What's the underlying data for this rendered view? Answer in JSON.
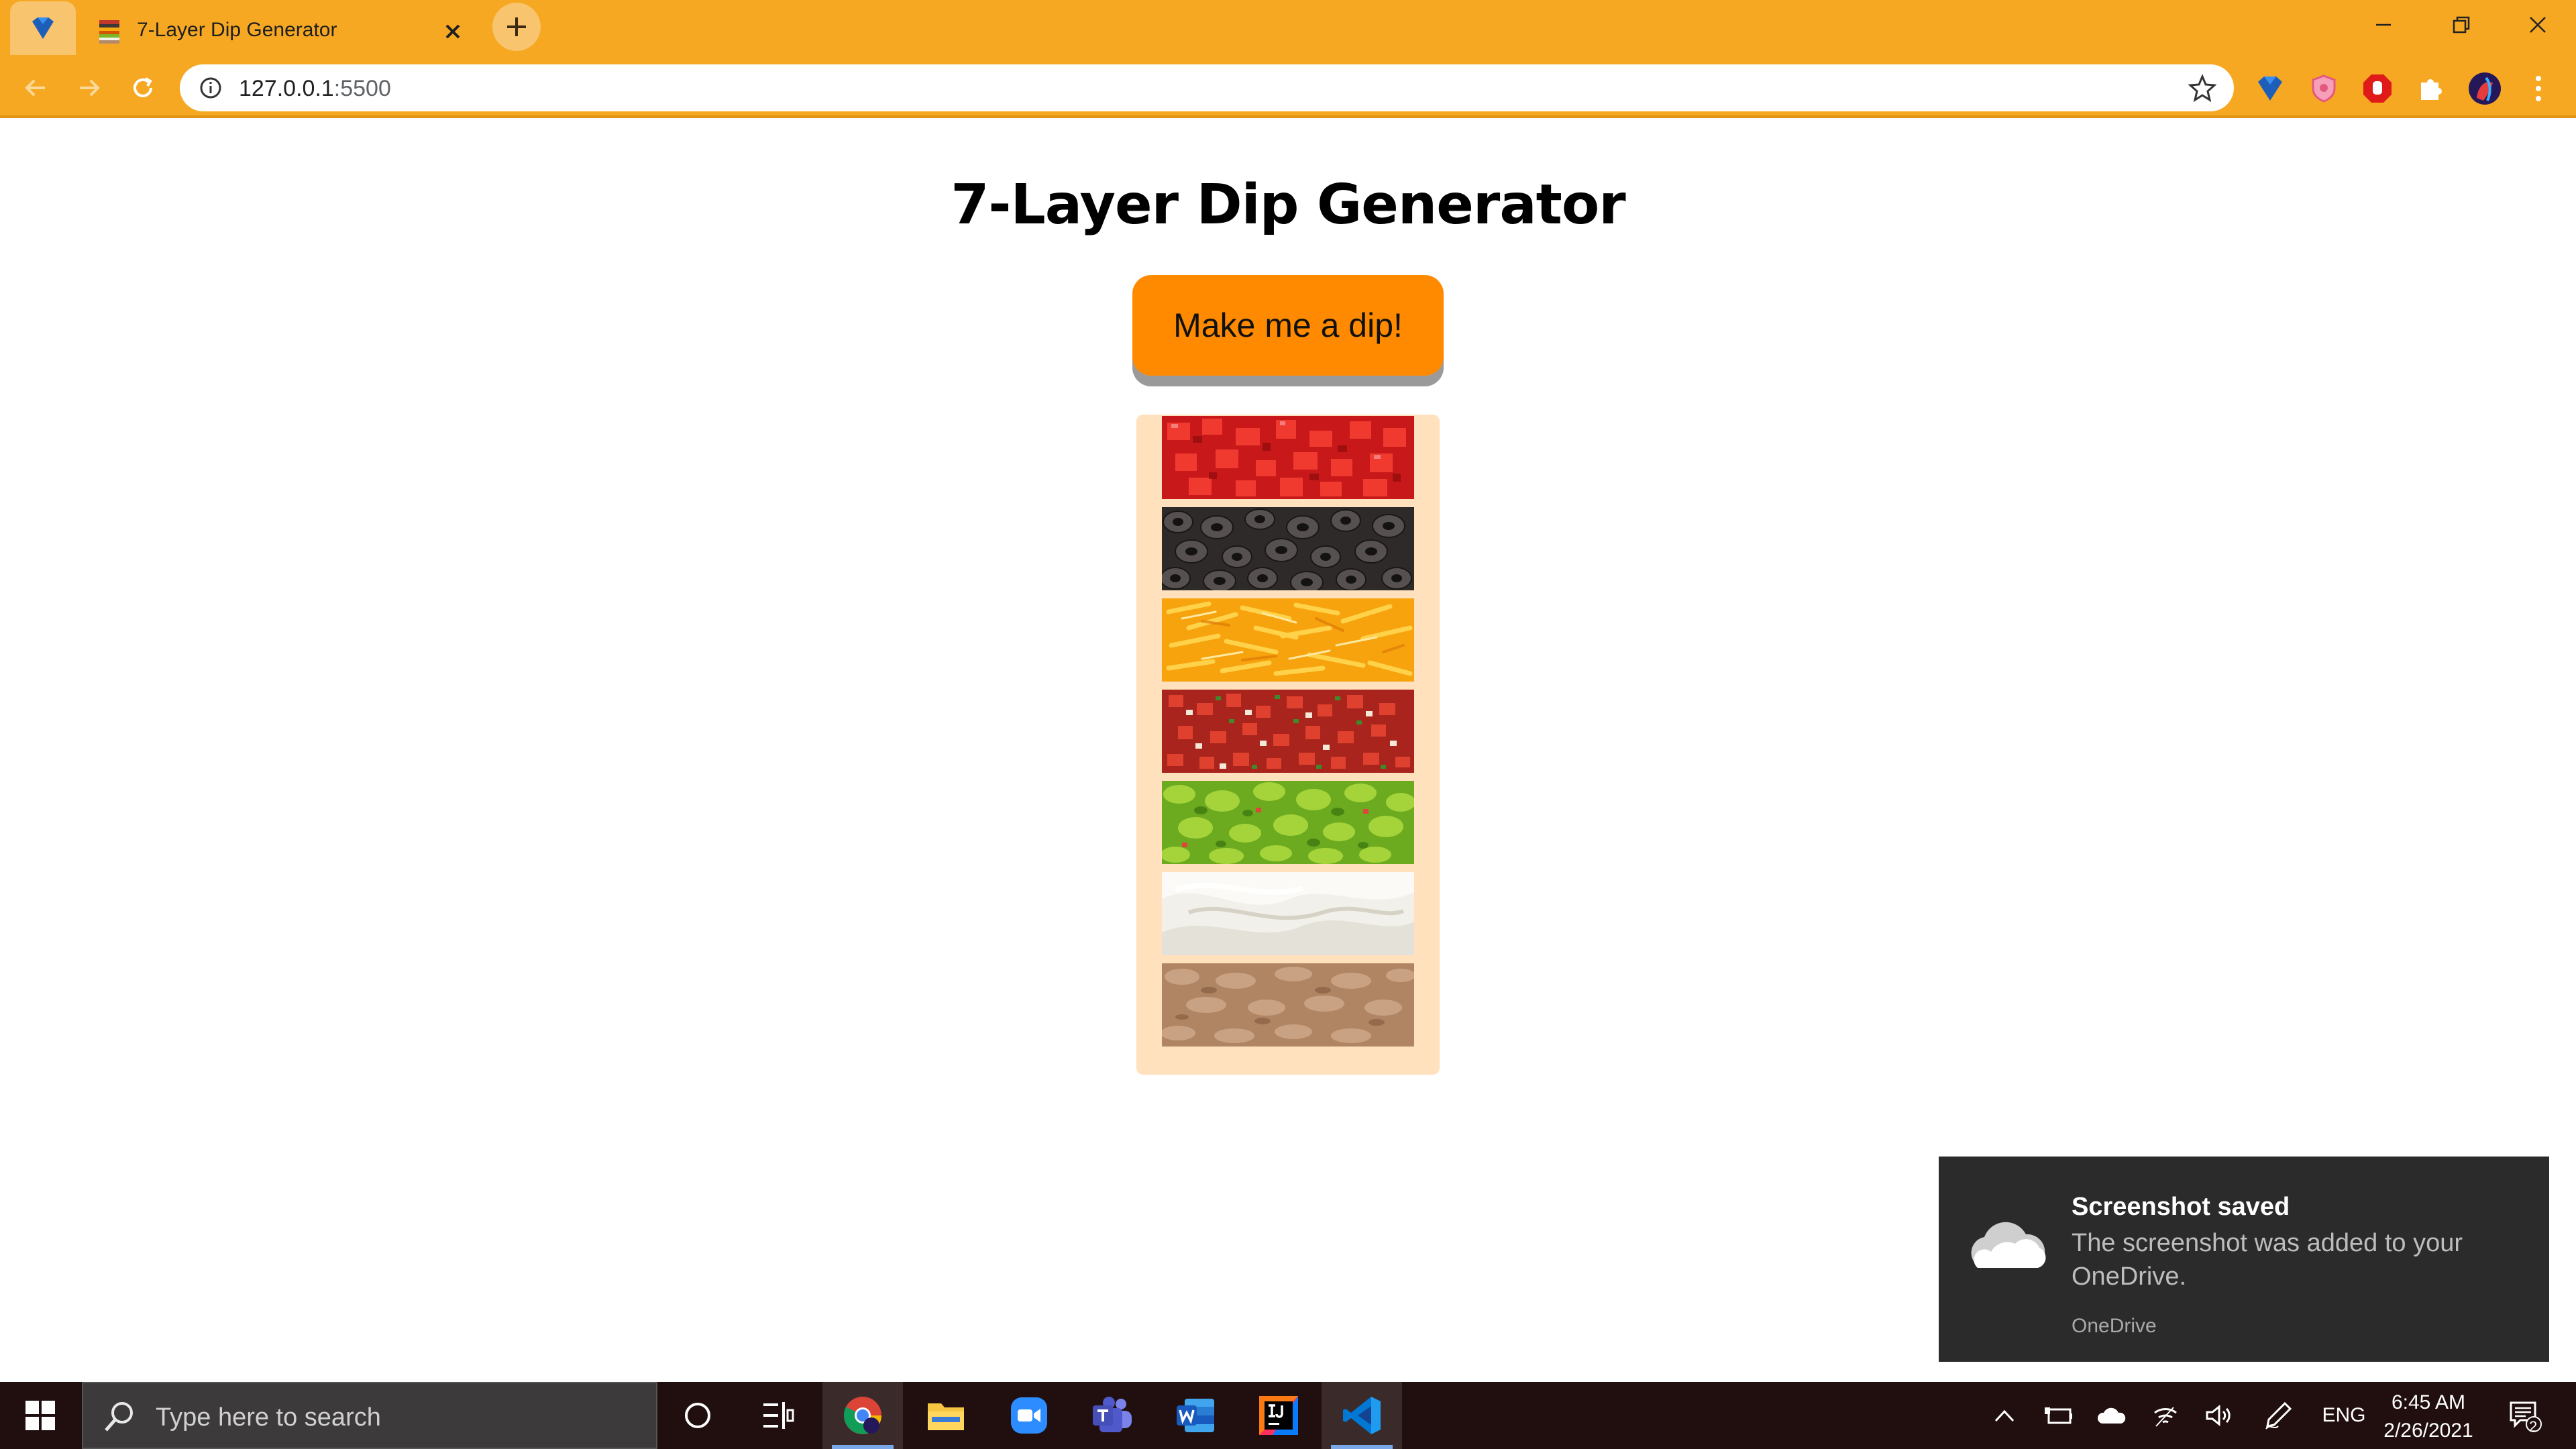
{
  "browser": {
    "tab_title": "7-Layer Dip Generator",
    "url_host": "127.0.0.1",
    "url_port": ":5500"
  },
  "page": {
    "title": "7-Layer Dip Generator",
    "button_label": "Make me a dip!",
    "layers": [
      {
        "name": "diced-tomatoes",
        "color": "#D8231C"
      },
      {
        "name": "black-olives",
        "color": "#3C3838"
      },
      {
        "name": "shredded-cheddar",
        "color": "#F7A912"
      },
      {
        "name": "salsa",
        "color": "#C0392B"
      },
      {
        "name": "guacamole",
        "color": "#7CB526"
      },
      {
        "name": "sour-cream",
        "color": "#F3F1EC"
      },
      {
        "name": "refried-beans",
        "color": "#B48A6A"
      }
    ]
  },
  "toast": {
    "title": "Screenshot saved",
    "body": "The screenshot was added to your OneDrive.",
    "source": "OneDrive"
  },
  "taskbar": {
    "search_placeholder": "Type here to search",
    "language": "ENG",
    "time": "6:45 AM",
    "date": "2/26/2021",
    "notification_count": "2"
  },
  "colors": {
    "chrome_accent": "#F6A823",
    "button_orange": "#FF8A00",
    "dip_background": "#FFE1BE",
    "taskbar": "#210F0F"
  }
}
